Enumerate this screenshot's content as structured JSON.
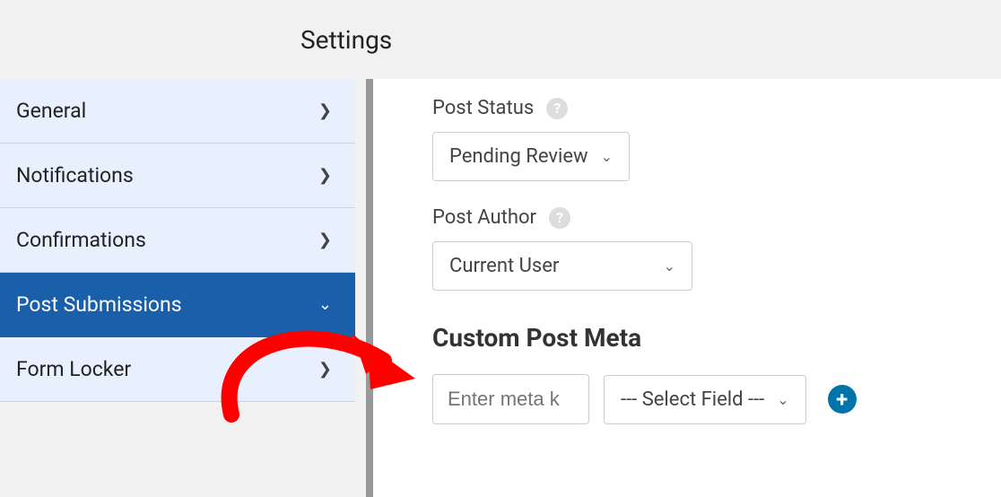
{
  "header": {
    "title": "Settings"
  },
  "sidebar": {
    "items": [
      {
        "label": "General"
      },
      {
        "label": "Notifications"
      },
      {
        "label": "Confirmations"
      },
      {
        "label": "Post Submissions"
      },
      {
        "label": "Form Locker"
      }
    ]
  },
  "main": {
    "post_status_label": "Post Status",
    "post_status_value": "Pending Review",
    "post_author_label": "Post Author",
    "post_author_value": "Current User",
    "custom_meta_heading": "Custom Post Meta",
    "meta_key_placeholder": "Enter meta k",
    "select_field_value": "--- Select Field ---"
  }
}
